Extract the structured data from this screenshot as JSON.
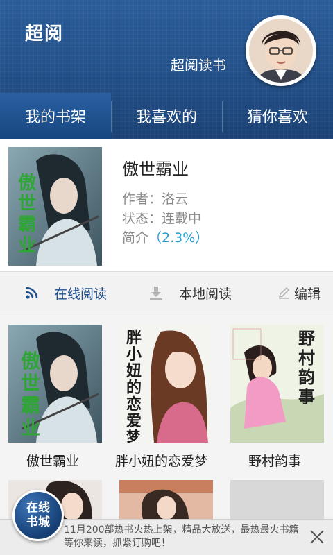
{
  "header": {
    "app_title": "超阅",
    "user_name": "超阅读书",
    "avatar_icon": "user-avatar"
  },
  "tabs": [
    {
      "label": "我的书架",
      "active": true
    },
    {
      "label": "我喜欢的",
      "active": false
    },
    {
      "label": "猜你喜欢",
      "active": false
    }
  ],
  "current_book": {
    "cover_text": "傲世霸业",
    "title": "傲世霸业",
    "author": "作者：洛云",
    "status": "状态：连载中",
    "intro_label": "简介",
    "progress": "（2.3%）"
  },
  "actions": {
    "online_read": "在线阅读",
    "local_read": "本地阅读",
    "edit": "编辑",
    "online_icon": "rss-icon",
    "local_icon": "download-icon",
    "edit_icon": "pencil-icon"
  },
  "shelf": [
    {
      "title": "傲世霸业",
      "cover_text": "傲世霸业"
    },
    {
      "title": "胖小妞的恋爱梦",
      "cover_text": "胖小妞的恋爱梦"
    },
    {
      "title": "野村韵事",
      "cover_text": "野村韵事"
    }
  ],
  "banner": {
    "store_label_1": "在线",
    "store_label_2": "书城",
    "text": "11月200部热书火热上架，精品大放送，最热最火书籍等你来读，抓紧订购吧！"
  },
  "colors": {
    "header": "#204b82",
    "accent": "#24a0d8",
    "link": "#1e4f8e"
  }
}
